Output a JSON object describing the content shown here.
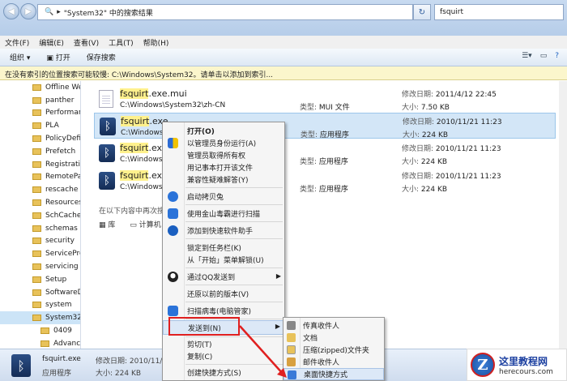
{
  "address": {
    "crumb": "\"System32\" 中的搜索结果",
    "arrow": "▸"
  },
  "search": {
    "value": "fsquirt"
  },
  "menubar": [
    "文件(F)",
    "编辑(E)",
    "查看(V)",
    "工具(T)",
    "帮助(H)"
  ],
  "toolbar": {
    "organize": "组织 ▾",
    "open": "打开",
    "save_search": "保存搜索"
  },
  "infobar": {
    "text": "在没有索引的位置搜索可能较慢: C:\\Windows\\System32。请单击以添加到索引..."
  },
  "tree": [
    {
      "label": "Offline We"
    },
    {
      "label": "panther"
    },
    {
      "label": "Performar"
    },
    {
      "label": "PLA"
    },
    {
      "label": "PolicyDefir"
    },
    {
      "label": "Prefetch"
    },
    {
      "label": "Registratic"
    },
    {
      "label": "RemotePa"
    },
    {
      "label": "rescache"
    },
    {
      "label": "Resources"
    },
    {
      "label": "SchCache"
    },
    {
      "label": "schemas"
    },
    {
      "label": "security"
    },
    {
      "label": "ServicePrc"
    },
    {
      "label": "servicing"
    },
    {
      "label": "Setup"
    },
    {
      "label": "SoftwareD"
    },
    {
      "label": "system"
    },
    {
      "label": "System32"
    },
    {
      "label": "0409"
    },
    {
      "label": "Advance"
    }
  ],
  "results": [
    {
      "name_hl": "fsquirt",
      "name_rest": ".exe.mui",
      "path": "C:\\Windows\\System32\\zh-CN",
      "type_label": "类型:",
      "type": "MUI 文件",
      "date_label": "修改日期:",
      "date": "2011/4/12 22:45",
      "size_label": "大小:",
      "size": "7.50 KB",
      "icon": "document-icon"
    },
    {
      "name_hl": "fsquirt",
      "name_rest": ".exe",
      "path": "C:\\Windows\\",
      "type_label": "类型:",
      "type": "应用程序",
      "date_label": "修改日期:",
      "date": "2010/11/21 11:23",
      "size_label": "大小:",
      "size": "224 KB",
      "icon": "bluetooth-icon"
    },
    {
      "name_hl": "fsquirt",
      "name_rest": ".exe",
      "path": "C:\\Windows\\",
      "type_label": "类型:",
      "type": "应用程序",
      "date_label": "修改日期:",
      "date": "2010/11/21 11:23",
      "size_label": "大小:",
      "size": "224 KB",
      "icon": "bluetooth-icon"
    },
    {
      "name_hl": "fsquirt",
      "name_rest": ".exe",
      "path": "C:\\Windows\\",
      "type_label": "类型:",
      "type": "应用程序",
      "date_label": "修改日期:",
      "date": "2010/11/21 11:23",
      "size_label": "大小:",
      "size": "224 KB",
      "icon": "bluetooth-icon"
    }
  ],
  "search_again": {
    "text": "在以下内容中再次搜索:",
    "library": "库",
    "computer": "计算机"
  },
  "status": {
    "name": "fsquirt.exe",
    "date_label": "修改日期:",
    "date": "2010/11/21 11:23",
    "type": "应用程序",
    "size_label": "大小:",
    "size": "224 KB"
  },
  "context_menu": [
    {
      "label": "打开(O)"
    },
    {
      "label": "以管理员身份运行(A)"
    },
    {
      "label": "管理员取得所有权"
    },
    {
      "label": "用记事本打开该文件"
    },
    {
      "label": "兼容性疑难解答(Y)"
    },
    {
      "label": "启动拷贝兔"
    },
    {
      "label": "使用金山毒霸进行扫描"
    },
    {
      "label": "添加到快速软件助手"
    },
    {
      "label": "锁定到任务栏(K)"
    },
    {
      "label": "从「开始」菜单解锁(U)"
    },
    {
      "label": "通过QQ发送到"
    },
    {
      "label": "还原以前的版本(V)"
    },
    {
      "label": "扫描病毒(电脑管家)"
    },
    {
      "label": "发送到(N)"
    },
    {
      "label": "剪切(T)"
    },
    {
      "label": "复制(C)"
    },
    {
      "label": "创建快捷方式(S)"
    }
  ],
  "send_to": [
    {
      "label": "传真收件人"
    },
    {
      "label": "文档"
    },
    {
      "label": "压缩(zipped)文件夹"
    },
    {
      "label": "邮件收件人"
    },
    {
      "label": "桌面快捷方式"
    }
  ],
  "watermark": {
    "logo": "Z",
    "title": "这里教程网",
    "url": "herecours.com"
  },
  "colors": {
    "highlight": "#fff18d",
    "selection": "#d3e6f7",
    "red_annotation": "#e02020"
  }
}
